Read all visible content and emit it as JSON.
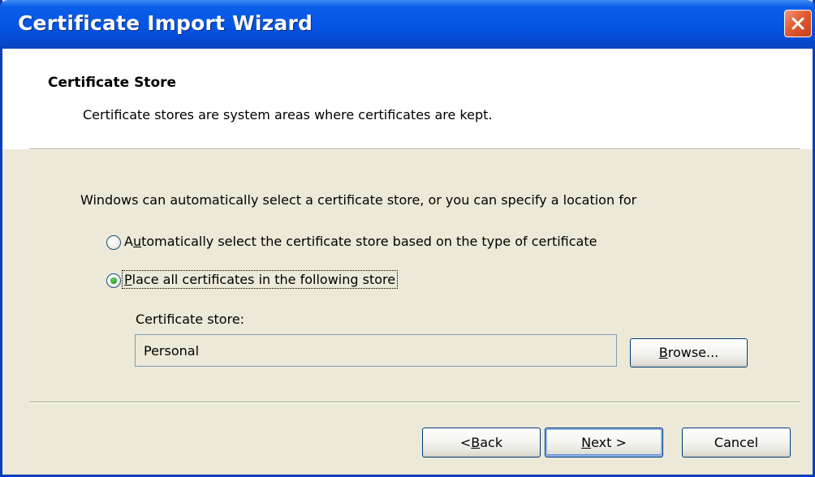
{
  "window": {
    "title": "Certificate Import Wizard"
  },
  "header": {
    "title": "Certificate Store",
    "subtitle": "Certificate stores are system areas where certificates are kept."
  },
  "main": {
    "intro": "Windows can automatically select a certificate store, or you can specify a location for",
    "options": [
      {
        "pre": "A",
        "key": "u",
        "post": "tomatically select the certificate store based on the type of certificate",
        "selected": false
      },
      {
        "pre": "",
        "key": "P",
        "post": "lace all certificates in the following store",
        "selected": true
      }
    ],
    "store_label": "Certificate store:",
    "store_value": "Personal",
    "browse": {
      "pre": "",
      "key": "B",
      "post": "rowse..."
    }
  },
  "buttons": {
    "back": {
      "pre": "< ",
      "key": "B",
      "post": "ack"
    },
    "next": {
      "pre": "",
      "key": "N",
      "post": "ext >"
    },
    "cancel": "Cancel"
  },
  "colors": {
    "titlebar": "#0554e3",
    "close_button": "#e25a30",
    "dialog_bg": "#ece9d8",
    "radio_dot": "#27a32c"
  }
}
